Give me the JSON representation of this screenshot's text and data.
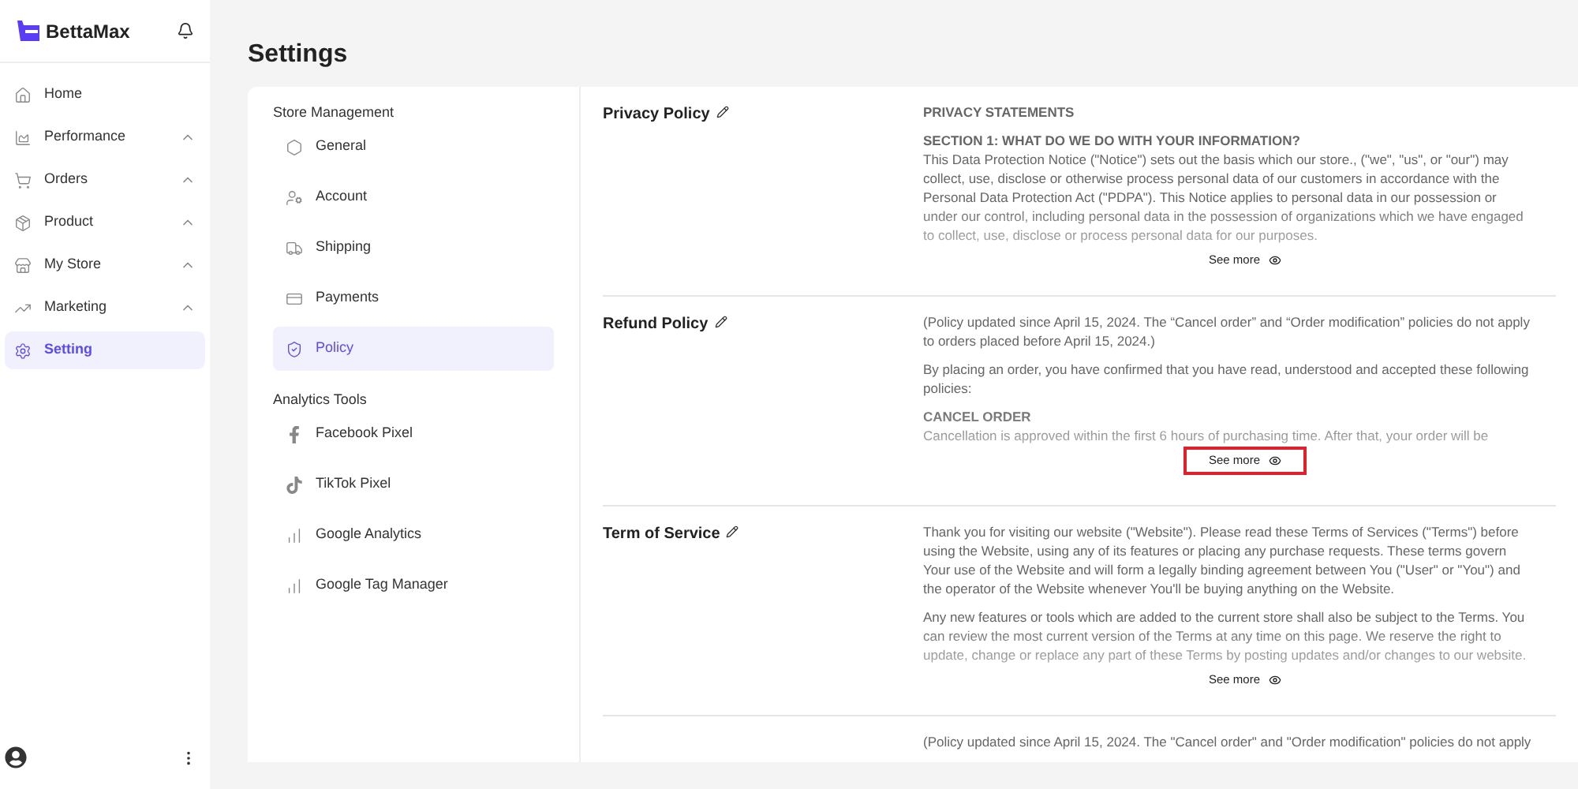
{
  "brand": {
    "name": "BettaMax"
  },
  "sidebar": {
    "items": [
      {
        "label": "Home",
        "kind": "link",
        "selected": false
      },
      {
        "label": "Performance",
        "kind": "group",
        "selected": false
      },
      {
        "label": "Orders",
        "kind": "group",
        "selected": false
      },
      {
        "label": "Product",
        "kind": "group",
        "selected": false
      },
      {
        "label": "My Store",
        "kind": "group",
        "selected": false
      },
      {
        "label": "Marketing",
        "kind": "group",
        "selected": false
      },
      {
        "label": "Setting",
        "kind": "link",
        "selected": true
      }
    ]
  },
  "page": {
    "title": "Settings"
  },
  "settings_nav": {
    "groups": [
      {
        "title": "Store Management",
        "items": [
          {
            "label": "General",
            "selected": false
          },
          {
            "label": "Account",
            "selected": false
          },
          {
            "label": "Shipping",
            "selected": false
          },
          {
            "label": "Payments",
            "selected": false
          },
          {
            "label": "Policy",
            "selected": true
          }
        ]
      },
      {
        "title": "Analytics Tools",
        "items": [
          {
            "label": "Facebook Pixel",
            "selected": false
          },
          {
            "label": "TikTok Pixel",
            "selected": false
          },
          {
            "label": "Google Analytics",
            "selected": false
          },
          {
            "label": "Google Tag Manager",
            "selected": false
          }
        ]
      }
    ]
  },
  "policies": [
    {
      "title": "Privacy Policy",
      "see_more": {
        "label": "See more",
        "highlighted": false
      },
      "blocks": [
        {
          "heading": "PRIVACY STATEMENTS"
        },
        {
          "heading": "SECTION 1: WHAT DO WE DO WITH YOUR INFORMATION?",
          "text": "This Data Protection Notice (\"Notice\") sets out the basis which our store., (\"we\", \"us\", or \"our\") may collect, use, disclose or otherwise process personal data of our customers in accordance with the Personal Data Protection Act (\"PDPA\"). This Notice applies to personal data in our possession or under our control, including personal data in the possession of organizations which we have engaged to collect, use, disclose or process personal data for our purposes."
        }
      ]
    },
    {
      "title": "Refund Policy",
      "see_more": {
        "label": "See more",
        "highlighted": true
      },
      "blocks": [
        {
          "text": "(Policy updated since April 15, 2024. The “Cancel order” and “Order modification” policies do not apply to orders placed before April 15, 2024.)"
        },
        {
          "text": "By placing an order, you have confirmed that you have read, understood and accepted these following policies:"
        },
        {
          "heading": "CANCEL ORDER",
          "text": "Cancellation is approved within the first 6 hours of purchasing time. After that, your order will be"
        }
      ]
    },
    {
      "title": "Term of Service",
      "see_more": {
        "label": "See more",
        "highlighted": false
      },
      "blocks": [
        {
          "text": "Thank you for visiting our website (\"Website\"). Please read these Terms of Services (\"Terms\") before using the Website, using any of its features or placing any purchase requests. These terms govern Your use of the Website and will form a legally binding agreement between You (\"User\" or \"You\") and the operator of the Website whenever You'll be buying anything on the Website."
        },
        {
          "text": "Any new features or tools which are added to the current store shall also be subject to the Terms. You can review the most current version of the Terms at any time on this page. We reserve the right to update, change or replace any part of these Terms by posting updates and/or changes to our website."
        }
      ]
    },
    {
      "blocks": [
        {
          "text": "(Policy updated since April 15, 2024. The \"Cancel order\" and \"Order modification\" policies do not apply"
        }
      ]
    }
  ]
}
